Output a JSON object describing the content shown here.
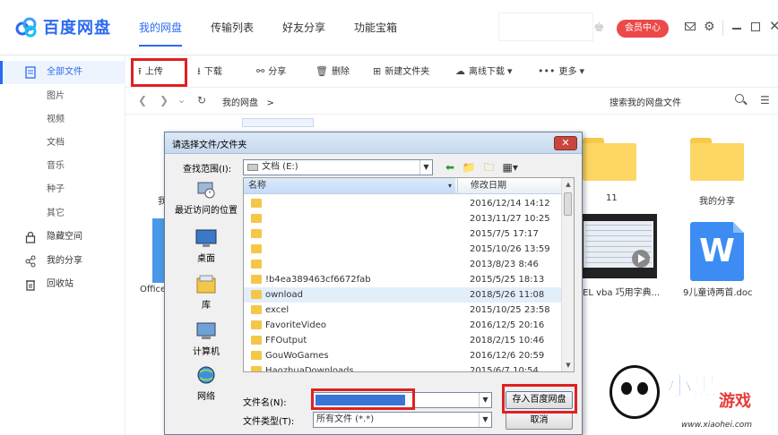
{
  "app": {
    "logo_text": "百度网盘"
  },
  "nav": {
    "tabs": [
      "我的网盘",
      "传输列表",
      "好友分享",
      "功能宝箱"
    ]
  },
  "header": {
    "vip_label": "会员中心"
  },
  "sidebar": {
    "items": [
      "全部文件",
      "图片",
      "视频",
      "文档",
      "音乐",
      "种子",
      "其它",
      "隐藏空间",
      "我的分享",
      "回收站"
    ]
  },
  "toolbar": {
    "upload": "上传",
    "download": "下载",
    "share": "分享",
    "delete": "删除",
    "new_folder": "新建文件夹",
    "offline": "离线下载",
    "more": "更多"
  },
  "pathbar": {
    "crumb": "我的网盘",
    "crumb_sep": ">",
    "search_placeholder": "搜索我的网盘文件"
  },
  "files": {
    "folder_11": "11",
    "folder_share": "我的分享",
    "left_label_1": "我",
    "left_label_2": "Office",
    "video_label": "EL vba 巧用字典...",
    "doc_label": "9儿童诗两首.doc",
    "word_glyph": "W"
  },
  "dialog": {
    "title": "请选择文件/文件夹",
    "close": "✕",
    "lookin_label": "查找范围(I):",
    "lookin_value": "文档  (E:)",
    "places": [
      "最近访问的位置",
      "桌面",
      "库",
      "计算机",
      "网络"
    ],
    "col_name": "名称",
    "col_date": "修改日期",
    "rows": [
      {
        "name": "",
        "date": "2016/12/14 14:12"
      },
      {
        "name": "",
        "date": "2013/11/27 10:25"
      },
      {
        "name": "",
        "date": "2015/7/5 17:17"
      },
      {
        "name": "",
        "date": "2015/10/26 13:59"
      },
      {
        "name": "",
        "date": "2013/8/23 8:46"
      },
      {
        "name": "!b4ea389463cf6672fab",
        "date": "2015/5/25 18:13"
      },
      {
        "name": "ownload",
        "date": "2018/5/26 11:08"
      },
      {
        "name": "excel",
        "date": "2015/10/25 23:58"
      },
      {
        "name": "FavoriteVideo",
        "date": "2016/12/5 20:16"
      },
      {
        "name": "FFOutput",
        "date": "2018/2/15 10:46"
      },
      {
        "name": "GouWoGames",
        "date": "2016/12/6 20:59"
      },
      {
        "name": "HaozhuaDownloads",
        "date": "2015/6/7 10:54"
      }
    ],
    "filename_label": "文件名(N):",
    "filetype_label": "文件类型(T):",
    "filetype_value": "所有文件 (*.*)",
    "save_label": "存入百度网盘",
    "cancel_label": "取消"
  },
  "watermark": {
    "brand": "小黑",
    "brand2": "游戏",
    "url": "www.xiaohei.com"
  }
}
